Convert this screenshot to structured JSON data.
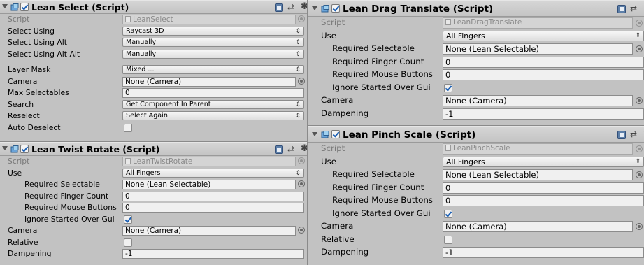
{
  "lean_select": {
    "title": "Lean Select (Script)",
    "script_label": "Script",
    "script_value": "LeanSelect",
    "select_using_label": "Select Using",
    "select_using_value": "Raycast 3D",
    "select_using_alt_label": "Select Using Alt",
    "select_using_alt_value": "Manually",
    "select_using_alt_alt_label": "Select Using Alt Alt",
    "select_using_alt_alt_value": "Manually",
    "layer_mask_label": "Layer Mask",
    "layer_mask_value": "Mixed ...",
    "camera_label": "Camera",
    "camera_value": "None (Camera)",
    "max_selectables_label": "Max Selectables",
    "max_selectables_value": "0",
    "search_label": "Search",
    "search_value": "Get Component In Parent",
    "reselect_label": "Reselect",
    "reselect_value": "Select Again",
    "auto_deselect_label": "Auto Deselect",
    "auto_deselect_checked": false
  },
  "lean_twist_rotate": {
    "title": "Lean Twist Rotate (Script)",
    "script_label": "Script",
    "script_value": "LeanTwistRotate",
    "use_label": "Use",
    "use_value": "All Fingers",
    "required_selectable_label": "Required Selectable",
    "required_selectable_value": "None (Lean Selectable)",
    "required_finger_count_label": "Required Finger Count",
    "required_finger_count_value": "0",
    "required_mouse_buttons_label": "Required Mouse Buttons",
    "required_mouse_buttons_value": "0",
    "ignore_started_over_gui_label": "Ignore Started Over Gui",
    "ignore_started_over_gui_checked": true,
    "camera_label": "Camera",
    "camera_value": "None (Camera)",
    "relative_label": "Relative",
    "relative_checked": false,
    "dampening_label": "Dampening",
    "dampening_value": "-1"
  },
  "lean_drag_translate": {
    "title": "Lean Drag Translate (Script)",
    "script_label": "Script",
    "script_value": "LeanDragTranslate",
    "use_label": "Use",
    "use_value": "All Fingers",
    "required_selectable_label": "Required Selectable",
    "required_selectable_value": "None (Lean Selectable)",
    "required_finger_count_label": "Required Finger Count",
    "required_finger_count_value": "0",
    "required_mouse_buttons_label": "Required Mouse Buttons",
    "required_mouse_buttons_value": "0",
    "ignore_started_over_gui_label": "Ignore Started Over Gui",
    "ignore_started_over_gui_checked": true,
    "camera_label": "Camera",
    "camera_value": "None (Camera)",
    "dampening_label": "Dampening",
    "dampening_value": "-1"
  },
  "lean_pinch_scale": {
    "title": "Lean Pinch Scale (Script)",
    "script_label": "Script",
    "script_value": "LeanPinchScale",
    "use_label": "Use",
    "use_value": "All Fingers",
    "required_selectable_label": "Required Selectable",
    "required_selectable_value": "None (Lean Selectable)",
    "required_finger_count_label": "Required Finger Count",
    "required_finger_count_value": "0",
    "required_mouse_buttons_label": "Required Mouse Buttons",
    "required_mouse_buttons_value": "0",
    "ignore_started_over_gui_label": "Ignore Started Over Gui",
    "ignore_started_over_gui_checked": true,
    "camera_label": "Camera",
    "camera_value": "None (Camera)",
    "relative_label": "Relative",
    "relative_checked": false,
    "dampening_label": "Dampening",
    "dampening_value": "-1"
  },
  "icons": {
    "foldout": "triangle-down-icon",
    "script": "script-icon",
    "help": "help-book-icon",
    "preset": "preset-icon",
    "gear": "gear-icon",
    "picker": "object-picker-icon",
    "dropdown": "dropdown-arrow-icon"
  },
  "glyphs": {
    "dropdown_arrow": "⇕",
    "preset": "⇄",
    "gear": "✱"
  }
}
